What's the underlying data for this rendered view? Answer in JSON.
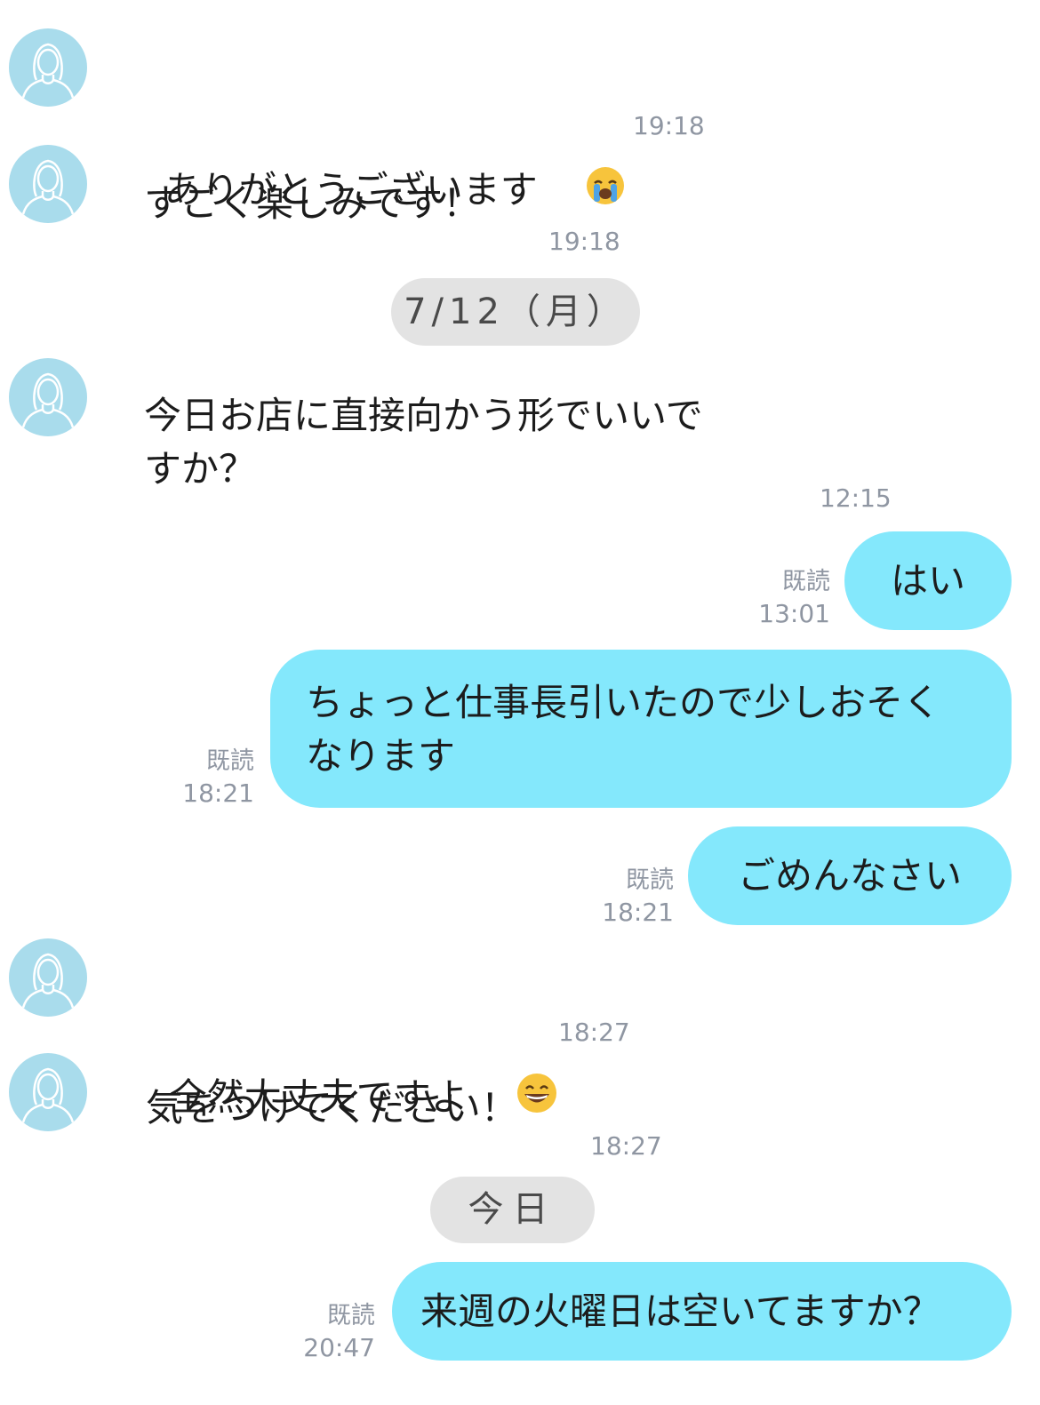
{
  "messages": {
    "m1": {
      "text": "ありがとうございます",
      "emoji": "crying-face-icon",
      "time": "19:18"
    },
    "m2": {
      "text": "すごく楽しみです！",
      "time": "19:18"
    },
    "date1": "7/12（月）",
    "m3": {
      "line1": "今日お店に直接向かう形でいいで",
      "line2": "すか？",
      "time": "12:15"
    },
    "o1": {
      "text": "はい",
      "read": "既読",
      "time": "13:01"
    },
    "o2": {
      "line1": "ちょっと仕事長引いたので少しおそく",
      "line2": "なります",
      "read": "既読",
      "time": "18:21"
    },
    "o3": {
      "text": "ごめんなさい",
      "read": "既読",
      "time": "18:21"
    },
    "m4": {
      "text": "全然大丈夫ですよ",
      "emoji": "grinning-face-icon",
      "time": "18:27"
    },
    "m5": {
      "text": "気をつけてください！",
      "time": "18:27"
    },
    "date2": "今日",
    "o4": {
      "text": "来週の火曜日は空いてますか？",
      "read": "既読",
      "time": "20:47"
    }
  },
  "colors": {
    "outgoing_bubble": "#84e8fc",
    "avatar_bg": "#a9dcec",
    "pill_bg": "#e3e3e3",
    "meta_text": "#8f96a2"
  }
}
